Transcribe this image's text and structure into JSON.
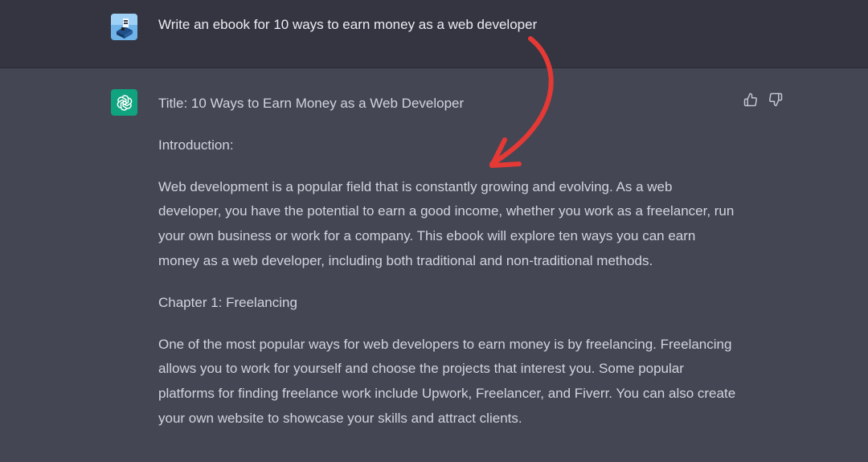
{
  "user_message": {
    "avatar_icon": "user-avatar-icon",
    "text": "Write an ebook for 10 ways to earn money as a web developer"
  },
  "assistant_message": {
    "avatar_icon": "openai-logo-icon",
    "paragraphs": [
      "Title: 10 Ways to Earn Money as a Web Developer",
      "Introduction:",
      "Web development is a popular field that is constantly growing and evolving. As a web developer, you have the potential to earn a good income, whether you work as a freelancer, run your own business or work for a company. This ebook will explore ten ways you can earn money as a web developer, including both traditional and non-traditional methods.",
      "Chapter 1: Freelancing",
      "One of the most popular ways for web developers to earn money is by freelancing. Freelancing allows you to work for yourself and choose the projects that interest you. Some popular platforms for finding freelance work include Upwork, Freelancer, and Fiverr. You can also create your own website to showcase your skills and attract clients."
    ],
    "feedback": {
      "thumbs_up_icon": "thumbs-up-icon",
      "thumbs_down_icon": "thumbs-down-icon"
    }
  },
  "annotation": {
    "arrow_icon": "red-curved-arrow-icon",
    "arrow_color": "#e53935"
  },
  "colors": {
    "user_bg": "#343541",
    "assistant_bg": "#444654",
    "text_primary": "#ececf1",
    "text_response": "#d1d5db",
    "gpt_green": "#10a37f"
  }
}
